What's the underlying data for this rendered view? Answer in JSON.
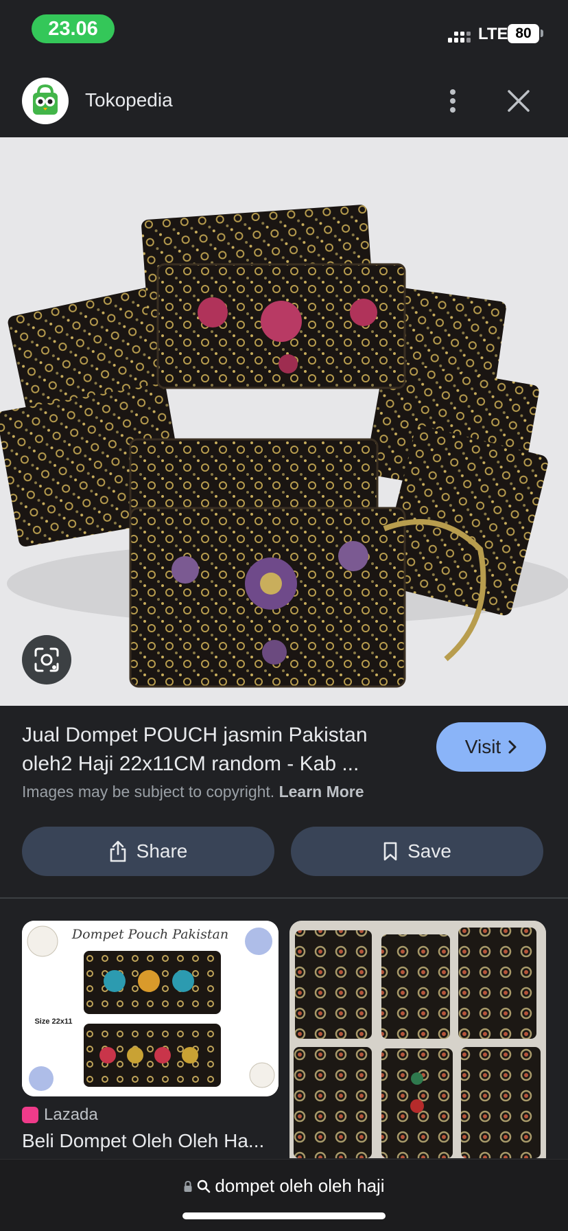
{
  "status_bar": {
    "time": "23.06",
    "network": "LTE",
    "battery": "80"
  },
  "header": {
    "site_name": "Tokopedia"
  },
  "result": {
    "title": "Jual Dompet POUCH jasmin Pakistan oleh2 Haji 22x11CM random - Kab ...",
    "visit_label": "Visit",
    "copyright_text": "Images may be subject to copyright.",
    "learn_more": "Learn More"
  },
  "actions": {
    "share_label": "Share",
    "save_label": "Save"
  },
  "related": [
    {
      "image_caption": "Dompet Pouch Pakistan",
      "image_size": "Size 22x11",
      "source": "Lazada",
      "title": "Beli Dompet Oleh Oleh Ha..."
    }
  ],
  "address_bar": {
    "query": "dompet oleh oleh haji"
  },
  "colors": {
    "accent": "#8ab4f8",
    "background": "#202124",
    "button": "#394457",
    "time_pill": "#34c759"
  }
}
